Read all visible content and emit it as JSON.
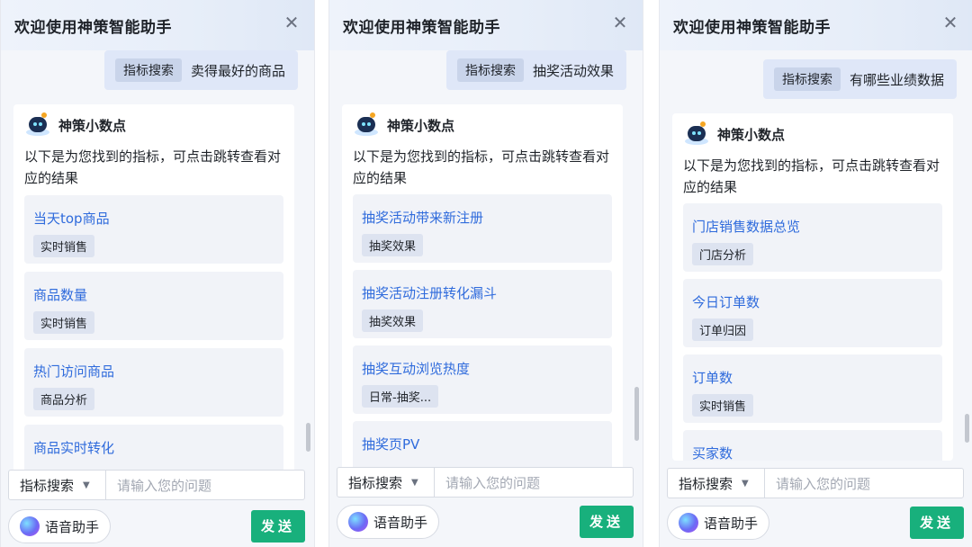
{
  "panels": [
    {
      "title": "欢迎使用神策智能助手",
      "user_tag": "指标搜索",
      "user_text": "卖得最好的商品",
      "bot_name": "神策小数点",
      "bot_message": "以下是为您找到的指标，可点击跳转查看对应的结果",
      "results": [
        {
          "title": "当天top商品",
          "tag": "实时销售"
        },
        {
          "title": "商品数量",
          "tag": "实时销售"
        },
        {
          "title": "热门访问商品",
          "tag": "商品分析"
        },
        {
          "title": "商品实时转化",
          "tag": ""
        }
      ],
      "dropdown_label": "指标搜索",
      "input_placeholder": "请输入您的问题",
      "voice_label": "语音助手",
      "send_label": "发送"
    },
    {
      "title": "欢迎使用神策智能助手",
      "user_tag": "指标搜索",
      "user_text": "抽奖活动效果",
      "bot_name": "神策小数点",
      "bot_message": "以下是为您找到的指标，可点击跳转查看对应的结果",
      "results": [
        {
          "title": "抽奖活动带来新注册",
          "tag": "抽奖效果"
        },
        {
          "title": "抽奖活动注册转化漏斗",
          "tag": "抽奖效果"
        },
        {
          "title": "抽奖互动浏览热度",
          "tag": "日常-抽奖..."
        },
        {
          "title": "抽奖页PV",
          "tag": ""
        }
      ],
      "dropdown_label": "指标搜索",
      "input_placeholder": "请输入您的问题",
      "voice_label": "语音助手",
      "send_label": "发送"
    },
    {
      "title": "欢迎使用神策智能助手",
      "user_tag": "指标搜索",
      "user_text": "有哪些业绩数据",
      "bot_name": "神策小数点",
      "bot_message": "以下是为您找到的指标，可点击跳转查看对应的结果",
      "results": [
        {
          "title": "门店销售数据总览",
          "tag": "门店分析"
        },
        {
          "title": "今日订单数",
          "tag": "订单归因"
        },
        {
          "title": "订单数",
          "tag": "实时销售"
        },
        {
          "title": "买家数",
          "tag": ""
        }
      ],
      "dropdown_label": "指标搜索",
      "input_placeholder": "请输入您的问题",
      "voice_label": "语音助手",
      "send_label": "发送"
    }
  ],
  "icons": {
    "close": "close-icon",
    "dropdown": "caret-down-icon",
    "voice": "voice-orb-icon",
    "avatar": "robot-avatar-icon"
  },
  "colors": {
    "link": "#2f6bdc",
    "send": "#18b07c",
    "user_bubble": "#dfe7f8"
  }
}
